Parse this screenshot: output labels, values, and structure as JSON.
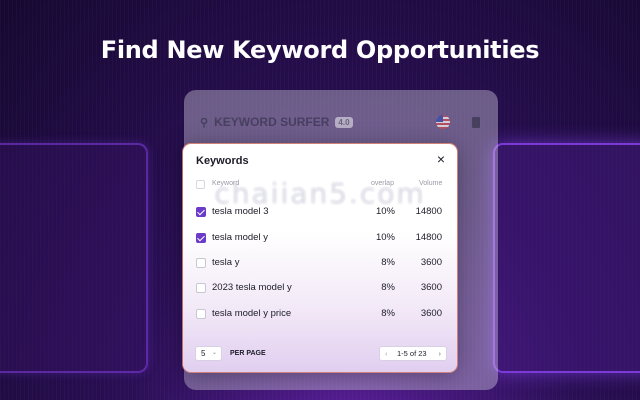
{
  "headline": "Find New Keyword Opportunities",
  "background_panel": {
    "brand": "KEYWORD SURFER",
    "version": "4.0",
    "icons": [
      "search-icon",
      "us-flag-icon",
      "document-icon"
    ]
  },
  "modal": {
    "title": "Keywords",
    "close_icon": "×",
    "columns": {
      "keyword": "Keyword",
      "overlap": "overlap",
      "volume": "Volume"
    },
    "rows": [
      {
        "keyword": "tesla model 3",
        "overlap": "10%",
        "volume": "14800",
        "checked": true
      },
      {
        "keyword": "tesla model y",
        "overlap": "10%",
        "volume": "14800",
        "checked": true
      },
      {
        "keyword": "tesla y",
        "overlap": "8%",
        "volume": "3600",
        "checked": false
      },
      {
        "keyword": "2023 tesla model y",
        "overlap": "8%",
        "volume": "3600",
        "checked": false
      },
      {
        "keyword": "tesla model y price",
        "overlap": "8%",
        "volume": "3600",
        "checked": false
      }
    ],
    "footer": {
      "per_page_value": "5",
      "per_page_label": "PER PAGE",
      "pagination": "1-5 of 23",
      "prev_icon": "‹",
      "next_icon": "›"
    }
  },
  "watermark": "chaiian5.com",
  "colors": {
    "accent": "#6a3bc9",
    "background": "#1e0b40"
  }
}
